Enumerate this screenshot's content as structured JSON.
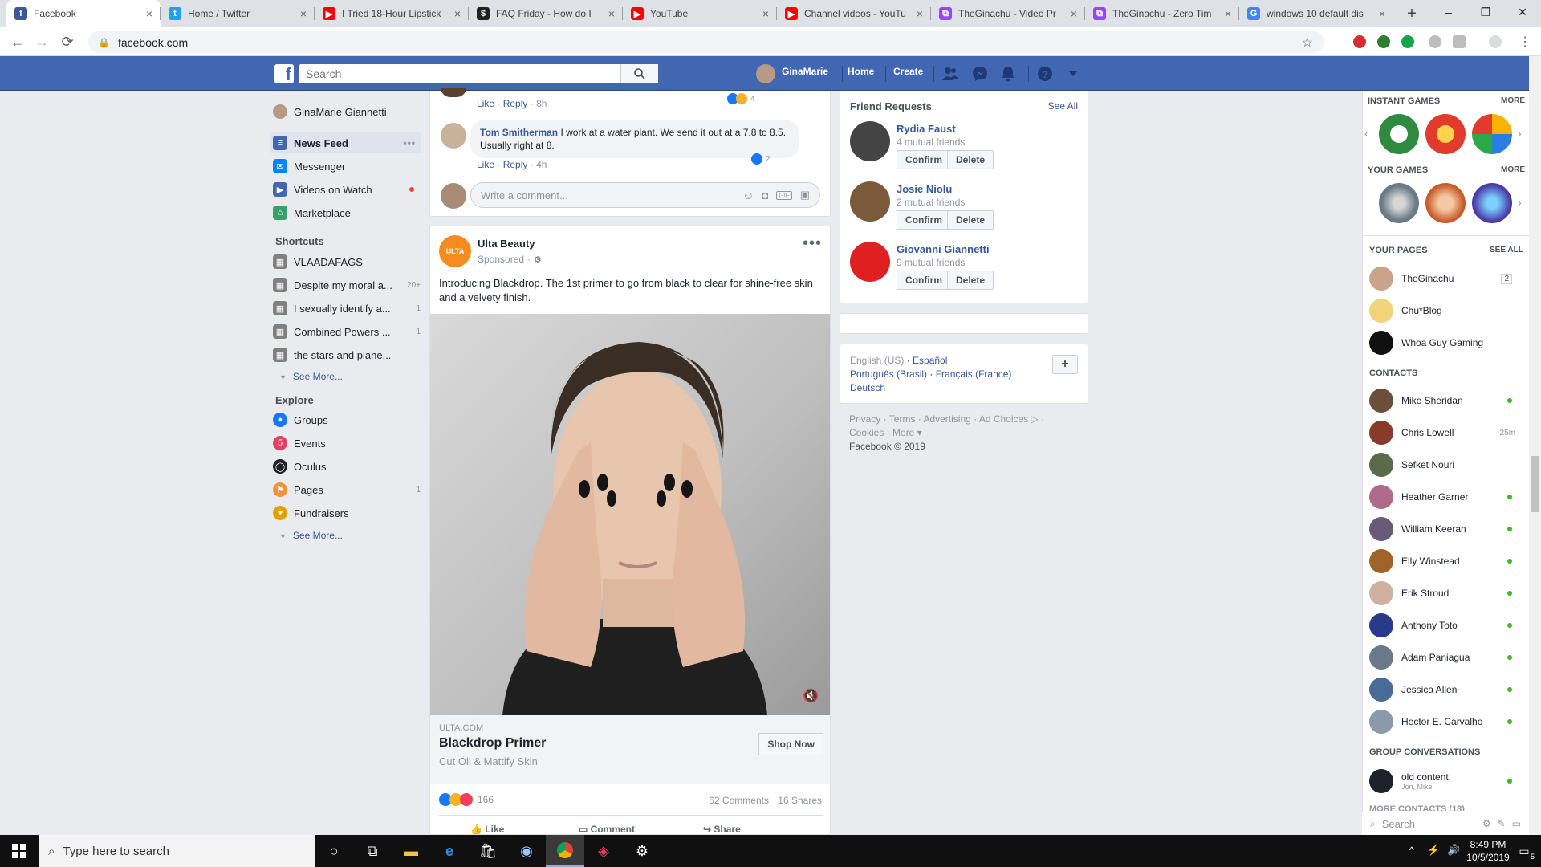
{
  "browser": {
    "tabs": [
      {
        "title": "Facebook",
        "color": "#3b5998",
        "glyph": "f"
      },
      {
        "title": "Home / Twitter",
        "color": "#1da1f2",
        "glyph": "t"
      },
      {
        "title": "I Tried 18-Hour Lipstick",
        "color": "#ff0000",
        "glyph": "▶"
      },
      {
        "title": "FAQ Friday - How do I",
        "color": "#202124",
        "glyph": "$"
      },
      {
        "title": "YouTube",
        "color": "#ff0000",
        "glyph": "▶"
      },
      {
        "title": "Channel videos - YouTu",
        "color": "#ff0000",
        "glyph": "▶"
      },
      {
        "title": "TheGinachu - Video Pr",
        "color": "#9146ff",
        "glyph": "⧉"
      },
      {
        "title": "TheGinachu - Zero Tim",
        "color": "#9146ff",
        "glyph": "⧉"
      },
      {
        "title": "windows 10 default dis",
        "color": "#4285f4",
        "glyph": "G"
      }
    ],
    "new_tab": "+",
    "url": "facebook.com"
  },
  "fb": {
    "search_placeholder": "Search",
    "profile_name": "GinaMarie",
    "nav_home": "Home",
    "nav_create": "Create"
  },
  "left": {
    "user_name": "GinaMarie Giannetti",
    "main_items": [
      {
        "label": "News Feed",
        "color": "#4267b2",
        "glyph": "≡"
      },
      {
        "label": "Messenger",
        "color": "#0084ff",
        "glyph": "✉"
      },
      {
        "label": "Videos on Watch",
        "color": "#4267b2",
        "glyph": "▶"
      },
      {
        "label": "Marketplace",
        "color": "#38a169",
        "glyph": "⌂"
      }
    ],
    "shortcuts_heading": "Shortcuts",
    "shortcuts": [
      {
        "label": "VLAADAFAGS",
        "count": ""
      },
      {
        "label": "Despite my moral a...",
        "count": "20+"
      },
      {
        "label": "I sexually identify a...",
        "count": "1"
      },
      {
        "label": "Combined Powers ...",
        "count": "1"
      },
      {
        "label": "the stars and plane...",
        "count": ""
      }
    ],
    "see_more": "See More...",
    "explore_heading": "Explore",
    "explore": [
      {
        "label": "Groups",
        "color": "#1877f2",
        "glyph": "●",
        "count": ""
      },
      {
        "label": "Events",
        "color": "#e4405f",
        "glyph": "5",
        "count": ""
      },
      {
        "label": "Oculus",
        "color": "#1d2129",
        "glyph": "◯",
        "count": ""
      },
      {
        "label": "Pages",
        "color": "#f7923b",
        "glyph": "⚑",
        "count": "1"
      },
      {
        "label": "Fundraisers",
        "color": "#e5a000",
        "glyph": "♥",
        "count": ""
      }
    ],
    "see_more2": "See More..."
  },
  "feed": {
    "top_comment_actions": {
      "like": "Like",
      "reply": "Reply",
      "time": "8h",
      "reacts": "4"
    },
    "comment": {
      "author": "Tom Smitherman",
      "text": "I work at a water plant. We send it out at a 7.8 to 8.5. Usually right at 8.",
      "like": "Like",
      "reply": "Reply",
      "time": "4h",
      "reacts": "2"
    },
    "write_comment": "Write a comment...",
    "ad": {
      "page": "Ulta Beauty",
      "logo_text": "ULTA",
      "sponsored": "Sponsored",
      "text": "Introducing Blackdrop. The 1st primer to go from black to clear for shine-free skin and a velvety finish.",
      "domain": "ULTA.COM",
      "title": "Blackdrop Primer",
      "subtitle": "Cut Oil & Mattify Skin",
      "cta": "Shop Now",
      "reactions": "166",
      "comments": "62 Comments",
      "shares": "16 Shares",
      "like": "Like",
      "comment": "Comment",
      "share": "Share"
    }
  },
  "friend_requests": {
    "heading": "Friend Requests",
    "see_all": "See All",
    "confirm": "Confirm",
    "delete": "Delete",
    "people": [
      {
        "name": "Rydia Faust",
        "mutual": "4 mutual friends",
        "color": "#444"
      },
      {
        "name": "Josie Niolu",
        "mutual": "2 mutual friends",
        "color": "#7a5a3a"
      },
      {
        "name": "Giovanni Giannetti",
        "mutual": "9 mutual friends",
        "color": "#e02020"
      }
    ]
  },
  "footer": {
    "lang_current": "English (US)",
    "langs": [
      "Español",
      "Português (Brasil)",
      "Français (France)",
      "Deutsch"
    ],
    "links": "Privacy · Terms · Advertising · Ad Choices ▷ ·",
    "links2": "Cookies · More ▾",
    "copyright": "Facebook © 2019"
  },
  "right": {
    "instant_games": "INSTANT GAMES",
    "more": "MORE",
    "your_games": "YOUR GAMES",
    "your_pages": "YOUR PAGES",
    "see_all": "SEE ALL",
    "pages": [
      {
        "name": "TheGinachu",
        "badge": "2",
        "color": "#c9a48a"
      },
      {
        "name": "Chu*Blog",
        "badge": "",
        "color": "#f2d27a"
      },
      {
        "name": "Whoa Guy Gaming",
        "badge": "",
        "color": "#111111"
      }
    ],
    "contacts_heading": "CONTACTS",
    "contacts": [
      {
        "name": "Mike Sheridan",
        "status": "online",
        "color": "#6b4f3a"
      },
      {
        "name": "Chris Lowell",
        "status": "25m",
        "color": "#8a3a2a"
      },
      {
        "name": "Sefket Nouri",
        "status": "",
        "color": "#5a6a4a"
      },
      {
        "name": "Heather Garner",
        "status": "online",
        "color": "#b06a8a"
      },
      {
        "name": "William Keeran",
        "status": "online",
        "color": "#6a5a7a"
      },
      {
        "name": "Elly Winstead",
        "status": "online",
        "color": "#a0632a"
      },
      {
        "name": "Erik Stroud",
        "status": "online",
        "color": "#d0b0a0"
      },
      {
        "name": "Anthony Toto",
        "status": "online",
        "color": "#2a3a8a"
      },
      {
        "name": "Adam Paniagua",
        "status": "online",
        "color": "#6a7a8a"
      },
      {
        "name": "Jessica Allen",
        "status": "online",
        "color": "#4a6a9a"
      },
      {
        "name": "Hector E. Carvalho",
        "status": "online",
        "color": "#8a9aaa"
      }
    ],
    "group_heading": "GROUP CONVERSATIONS",
    "group": {
      "name": "old content",
      "members": "Jon, Mike"
    },
    "more_contacts": "MORE CONTACTS (18)",
    "search_placeholder": "Search"
  },
  "taskbar": {
    "search_placeholder": "Type here to search",
    "time": "8:49 PM",
    "date": "10/5/2019",
    "notifications": "5"
  }
}
